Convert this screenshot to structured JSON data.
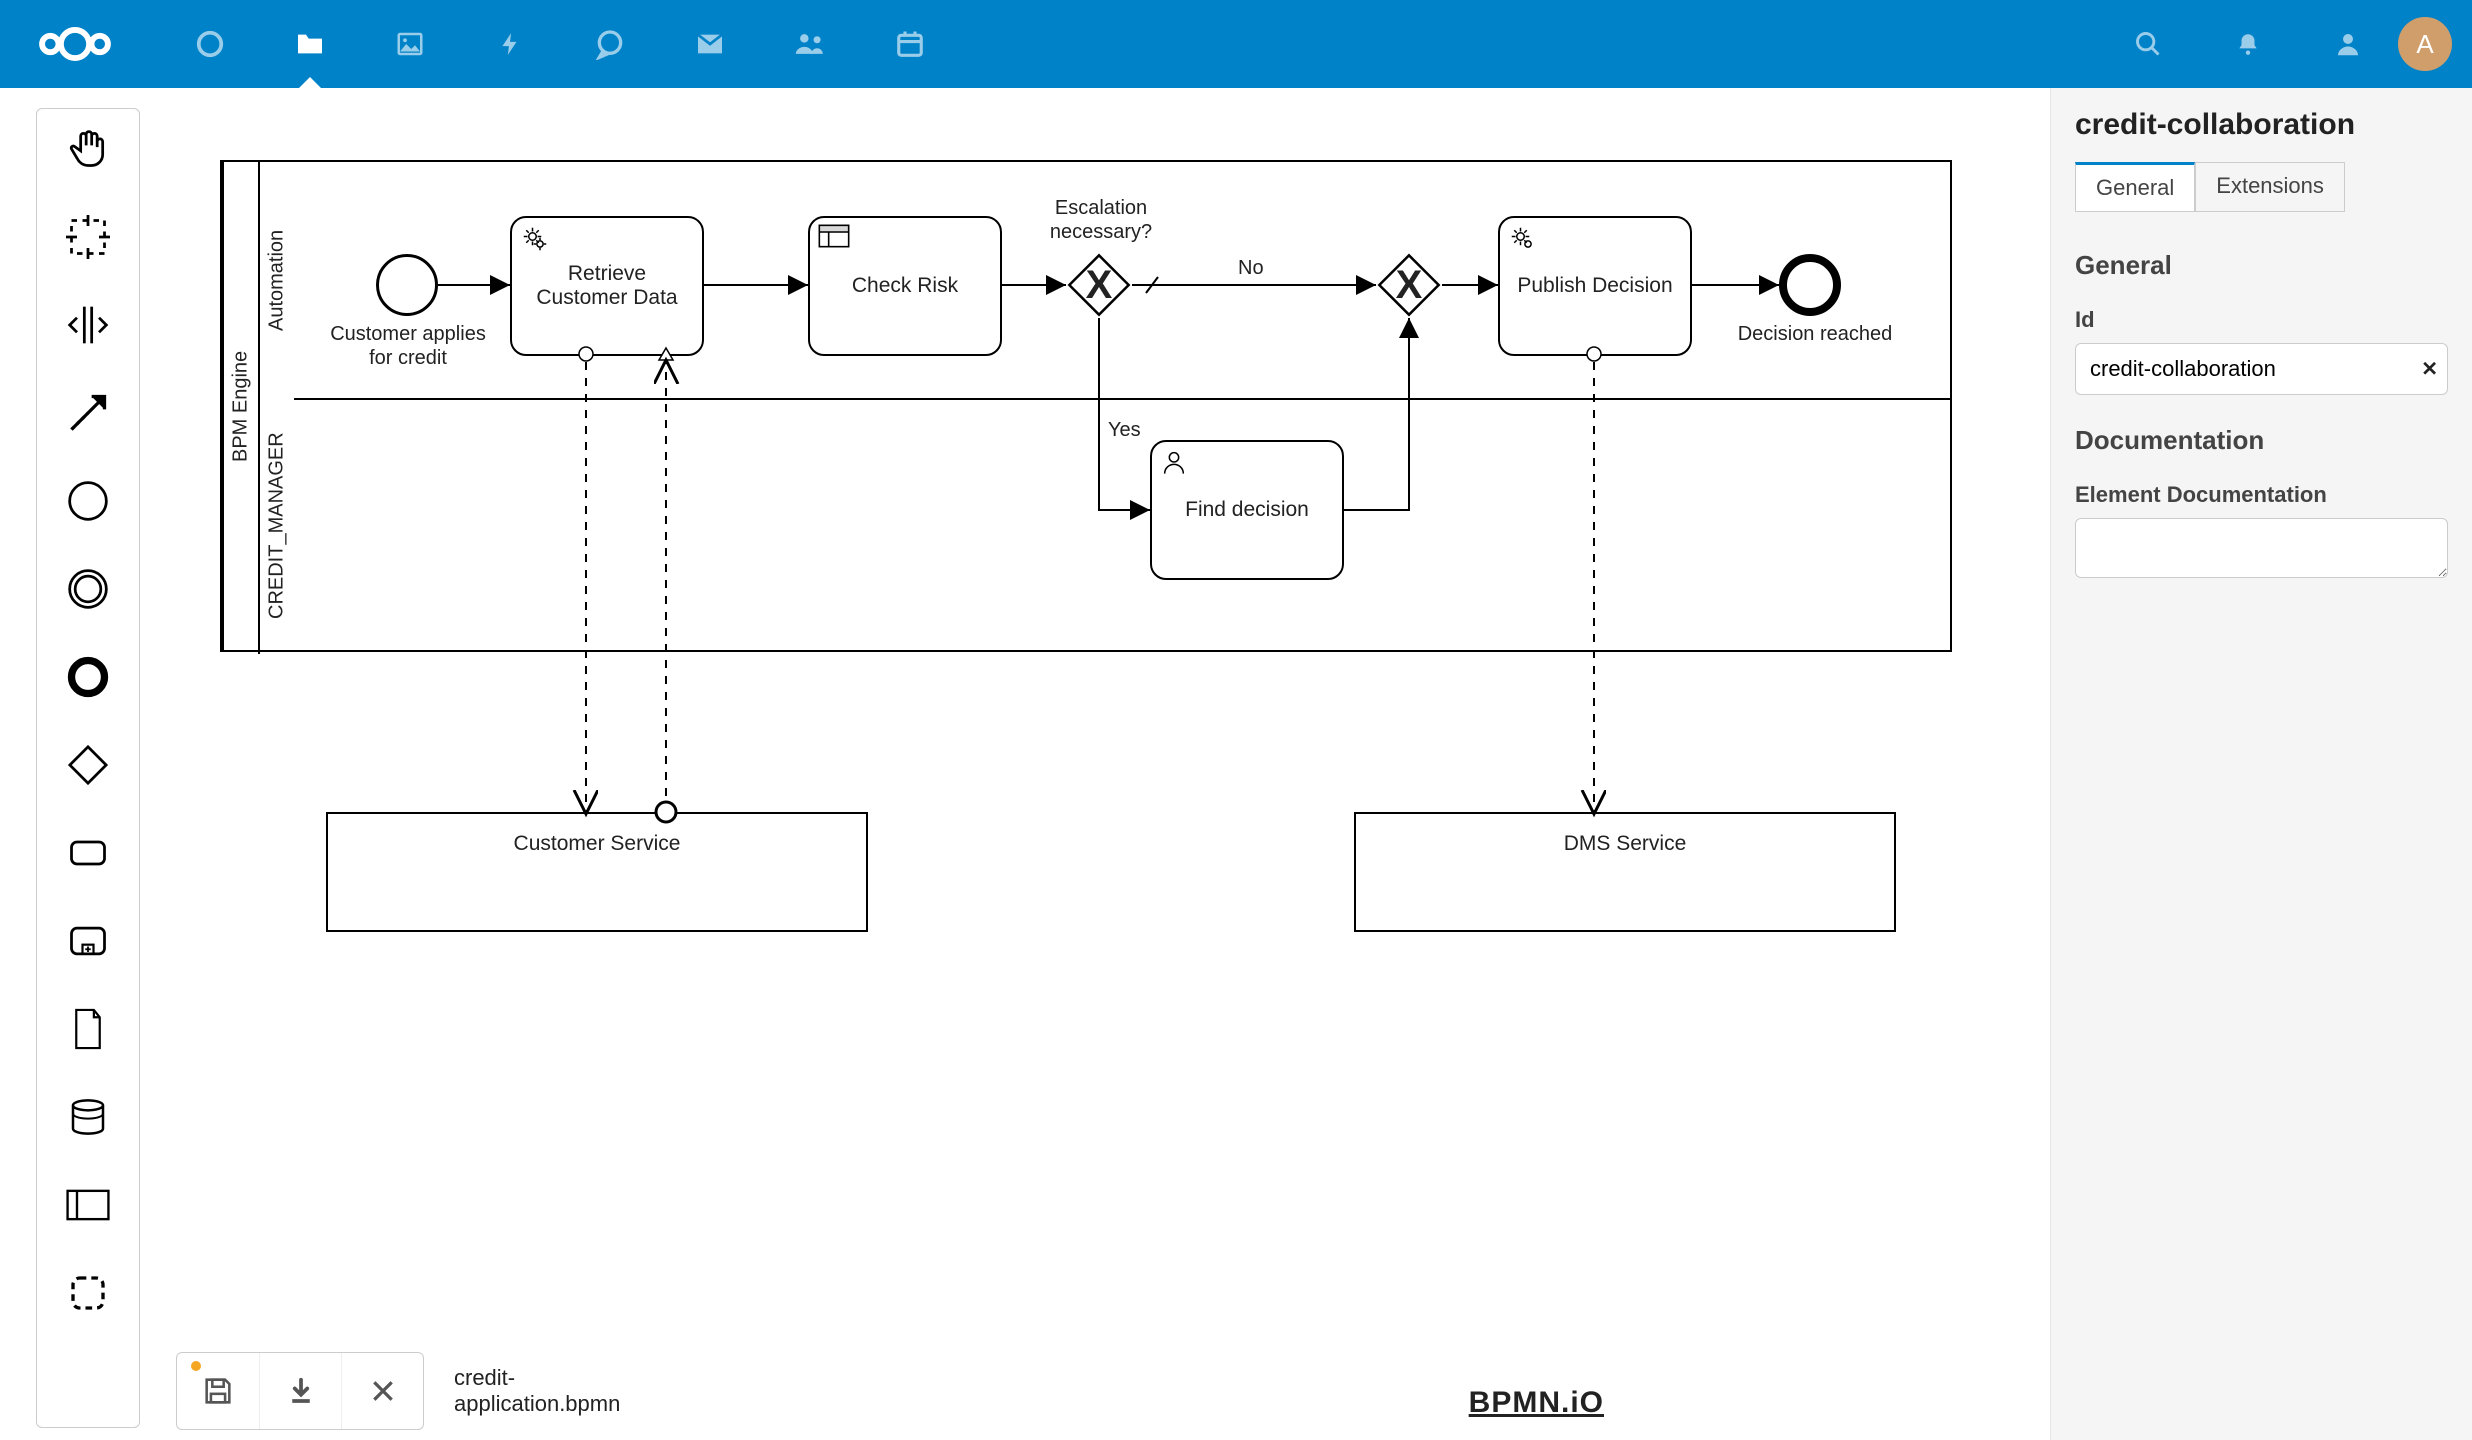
{
  "topbar": {
    "avatar_letter": "A"
  },
  "filename": "credit-\napplication.bpmn",
  "footer_logo": "BPMN.iO",
  "properties": {
    "title": "credit-collaboration",
    "tabs": {
      "general": "General",
      "extensions": "Extensions"
    },
    "section_general": "General",
    "field_id_label": "Id",
    "id_value": "credit-collaboration",
    "section_doc": "Documentation",
    "field_doc_label": "Element Documentation",
    "doc_value": ""
  },
  "diagram": {
    "pool_label": "BPM Engine",
    "lane1": "Automation",
    "lane2": "CREDIT_MANAGER",
    "start_label": "Customer applies\nfor credit",
    "task_retrieve": "Retrieve\nCustomer Data",
    "task_check": "Check Risk",
    "gateway_label": "Escalation\nnecessary?",
    "edge_no": "No",
    "edge_yes": "Yes",
    "task_find": "Find decision",
    "task_publish": "Publish Decision",
    "end_label": "Decision reached",
    "ext1": "Customer Service",
    "ext2": "DMS Service"
  }
}
